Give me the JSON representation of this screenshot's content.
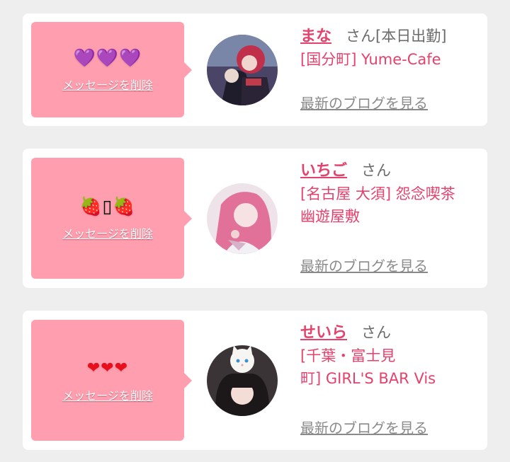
{
  "colors": {
    "accent": "#e4426c",
    "bubble": "#ff9eae",
    "background": "#eeeeee"
  },
  "messages": [
    {
      "emoji": "💜💜💜",
      "delete_label": "メッセージを削除",
      "name": "まな",
      "honorific": "さん",
      "status": "[本日出勤]",
      "shop_lines": [
        "[国分町] Yume-Cafe"
      ],
      "blog_label": "最新のブログを見る"
    },
    {
      "emoji": "🍓▯🍓",
      "delete_label": "メッセージを削除",
      "name": "いちご",
      "honorific": "さん",
      "status": "",
      "shop_lines": [
        "[名古屋 大須] 怨念喫茶",
        "幽遊屋敷"
      ],
      "blog_label": "最新のブログを見る"
    },
    {
      "emoji": "❤❤❤",
      "delete_label": "メッセージを削除",
      "name": "せいら",
      "honorific": "さん",
      "status": "",
      "shop_lines": [
        "[千葉・富士見",
        "町] GIRL'S BAR Vis"
      ],
      "blog_label": "最新のブログを見る"
    }
  ]
}
